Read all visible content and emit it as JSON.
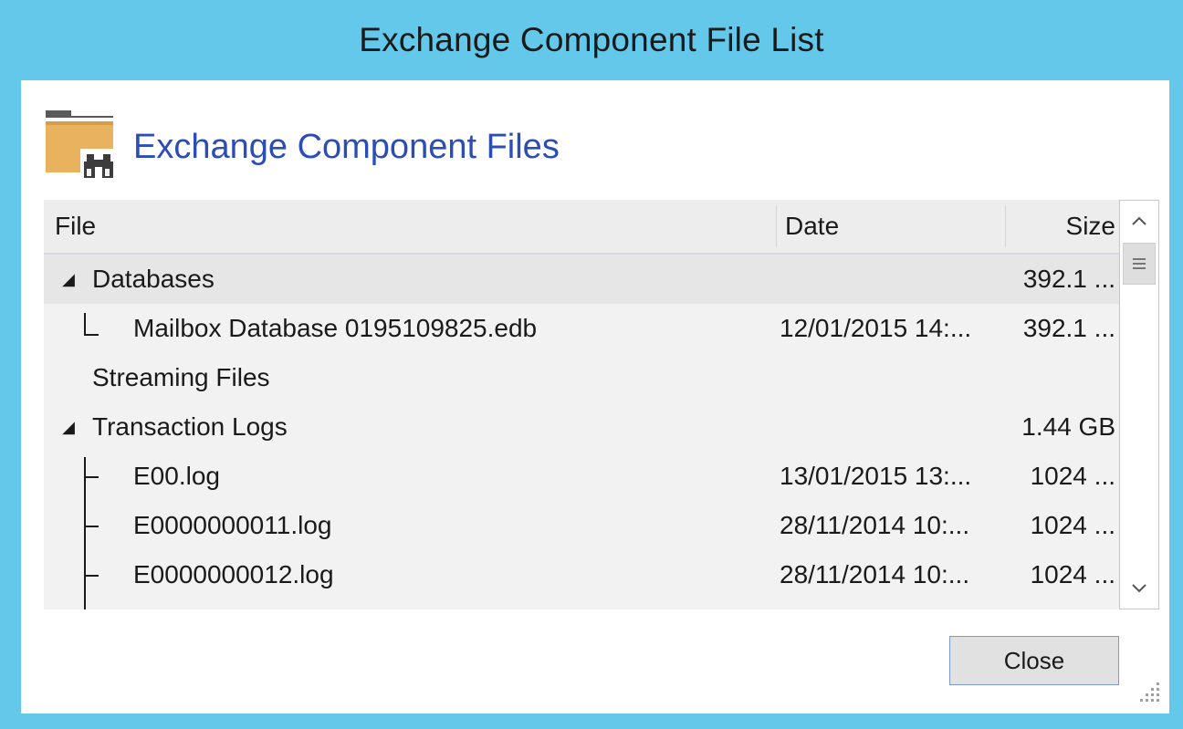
{
  "window": {
    "title": "Exchange Component File List"
  },
  "header": {
    "title": "Exchange Component Files",
    "icon": "folder-binoculars-icon"
  },
  "columns": {
    "file": "File",
    "date": "Date",
    "size": "Size"
  },
  "rows": [
    {
      "name": "Databases",
      "date": "",
      "size": "392.1 ...",
      "level": 0,
      "expanded": true
    },
    {
      "name": "Mailbox Database 0195109825.edb",
      "date": "12/01/2015 14:...",
      "size": "392.1 ...",
      "level": 1
    },
    {
      "name": "Streaming Files",
      "date": "",
      "size": "",
      "level": 0
    },
    {
      "name": "Transaction Logs",
      "date": "",
      "size": "1.44 GB",
      "level": 0,
      "expanded": true
    },
    {
      "name": "E00.log",
      "date": "13/01/2015 13:...",
      "size": "1024 ...",
      "level": 1
    },
    {
      "name": "E0000000011.log",
      "date": "28/11/2014 10:...",
      "size": "1024 ...",
      "level": 1
    },
    {
      "name": "E0000000012.log",
      "date": "28/11/2014 10:...",
      "size": "1024 ...",
      "level": 1
    }
  ],
  "footer": {
    "close_label": "Close"
  },
  "colors": {
    "frame": "#63c8ea",
    "header_text": "#2b4db5",
    "folder": "#e8b25e"
  }
}
